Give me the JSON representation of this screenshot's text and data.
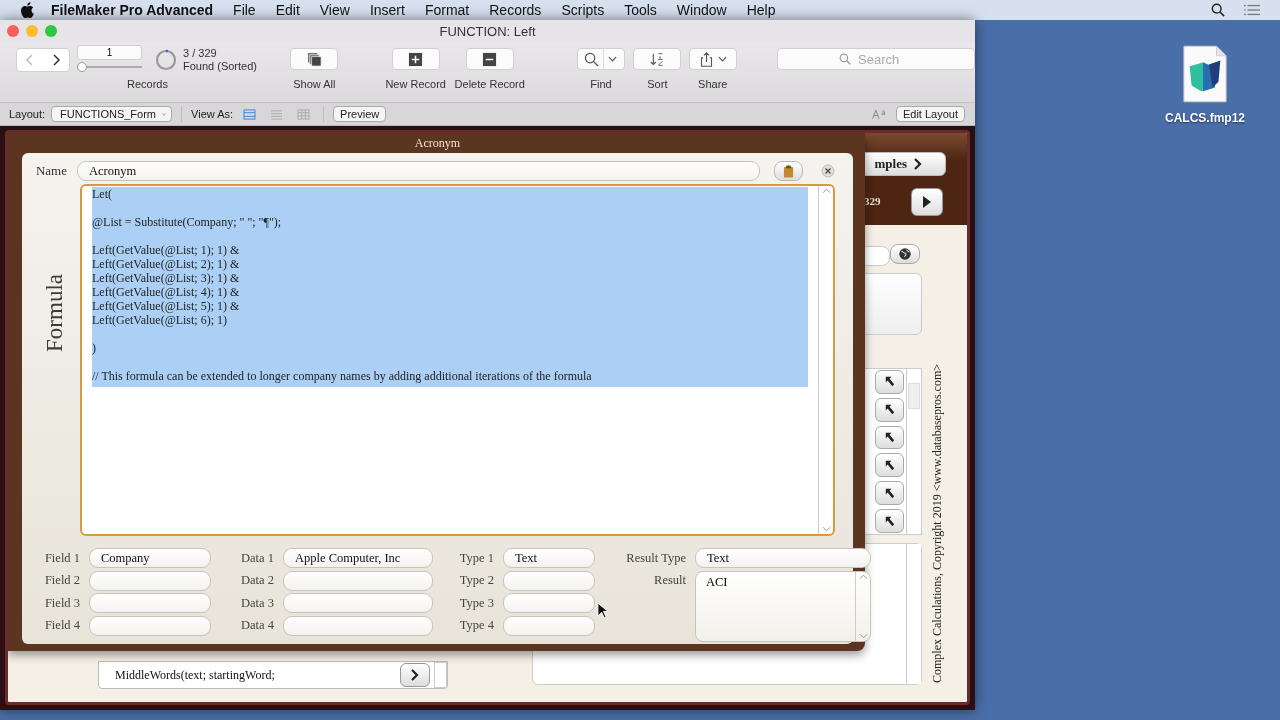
{
  "menu_bar": {
    "app_name": "FileMaker Pro Advanced",
    "items": [
      "File",
      "Edit",
      "View",
      "Insert",
      "Format",
      "Records",
      "Scripts",
      "Tools",
      "Window",
      "Help"
    ]
  },
  "window": {
    "title": "FUNCTION: Left"
  },
  "toolbar": {
    "record_number": "1",
    "record_slider": {
      "level": 0
    },
    "record_count": "3 / 329",
    "found_status": "Found (Sorted)",
    "records_label": "Records",
    "buttons": [
      {
        "kind": "show_all",
        "label": "Show All"
      },
      {
        "kind": "new",
        "label": "New Record"
      },
      {
        "kind": "delete",
        "label": "Delete Record"
      },
      {
        "kind": "find",
        "label": "Find"
      },
      {
        "kind": "sort",
        "label": "Sort"
      },
      {
        "kind": "share",
        "label": "Share"
      }
    ],
    "search": {
      "placeholder": "Search"
    }
  },
  "layout_bar": {
    "layout_label": "Layout:",
    "layout": "FUNCTIONS_Form",
    "view_as_label": "View As:",
    "view_modes": [
      {
        "kind": "form",
        "selected": true
      },
      {
        "kind": "list",
        "selected": false
      },
      {
        "kind": "table",
        "selected": false
      }
    ],
    "preview": "Preview",
    "edit_layout": "Edit Layout"
  },
  "background_layout": {
    "examples_button": "mples",
    "record_count": "329",
    "list_entry": "MiddleWords(text; startingWord;",
    "copyright": "Complex Calculations, Copyright 2019 <www.databasepros.com>"
  },
  "popup": {
    "title": "Acronym",
    "name_label": "Name",
    "name": "Acronym",
    "formula_label": "Formula",
    "formula": {
      "selected": true,
      "text": "Let(\n\n@List = Substitute(Company; \" \"; \"¶\");\n\nLeft(GetValue(@List; 1); 1) &\nLeft(GetValue(@List; 2); 1) &\nLeft(GetValue(@List; 3); 1) &\nLeft(GetValue(@List; 4); 1) &\nLeft(GetValue(@List; 5); 1) &\nLeft(GetValue(@List; 6); 1)\n\n)\n\n// This formula can be extended to longer company names by adding additional iterations of the formula"
    },
    "rows": [
      {
        "field_label": "Field 1",
        "field": "Company",
        "data_label": "Data 1",
        "data": "Apple Computer, Inc",
        "type_label": "Type 1",
        "type": "Text"
      },
      {
        "field_label": "Field 2",
        "data_label": "Data 2",
        "type_label": "Type 2"
      },
      {
        "field_label": "Field 3",
        "data_label": "Data 3",
        "type_label": "Type 3"
      },
      {
        "field_label": "Field 4",
        "data_label": "Data 4",
        "type_label": "Type 4"
      }
    ],
    "result_type_label": "Result Type",
    "result_type": "Text",
    "result_label": "Result",
    "result": "ACI"
  },
  "desktop": {
    "file_name": "CALCS.fmp12"
  }
}
